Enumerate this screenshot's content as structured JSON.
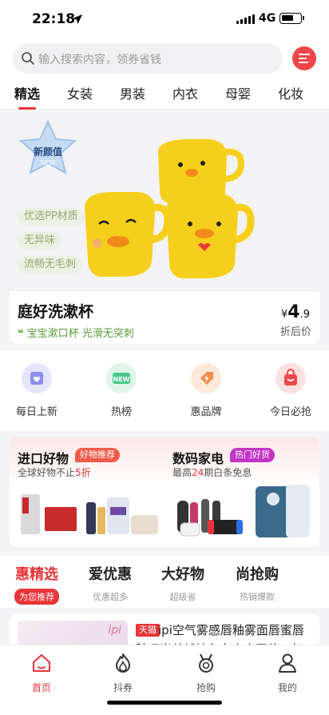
{
  "status": {
    "time": "22:18",
    "network": "4G"
  },
  "search": {
    "placeholder": "输入搜索内容，领券省钱"
  },
  "categories": [
    "精选",
    "女装",
    "男装",
    "内衣",
    "母婴",
    "化妆"
  ],
  "hero": {
    "badge_text": "新颜值",
    "badge_sub": "NEW",
    "features": [
      "优选PP材质",
      "无异味",
      "流畅无毛刺"
    ],
    "title": "庭好洗漱杯",
    "subtitle": "宝宝漱口杯 光滑无突刺",
    "currency": "¥",
    "price_int": "4",
    "price_dec": ".9",
    "price_label": "折后价"
  },
  "quick_links": [
    {
      "label": "每日上新",
      "icon": "calendar-heart-icon",
      "color": "#8c8ef0"
    },
    {
      "label": "热榜",
      "icon": "new-badge-icon",
      "color": "#4ac98c"
    },
    {
      "label": "惠品牌",
      "icon": "tag-lightning-icon",
      "color": "#f58a4a"
    },
    {
      "label": "今日必抢",
      "icon": "shopping-bag-icon",
      "color": "#f0464a"
    }
  ],
  "promo": {
    "left": {
      "title": "进口好物",
      "tag": "好物推荐",
      "sub_prefix": "全球好物不止",
      "sub_highlight": "5折",
      "sub_suffix": ""
    },
    "right": {
      "title": "数码家电",
      "tag": "热门好货",
      "sub_prefix": "最高",
      "sub_highlight": "24",
      "sub_suffix": "期白条免息"
    }
  },
  "sections": [
    {
      "title": "惠精选",
      "sub": "为您推荐"
    },
    {
      "title": "爱优惠",
      "sub": "优惠超多"
    },
    {
      "title": "大好物",
      "sub": "超级省"
    },
    {
      "title": "尚抢购",
      "sub": "热销爆款"
    }
  ],
  "product": {
    "brand_mark": "ipi",
    "store_tag": "天猫",
    "title": "ipi空气雾感唇釉雾面唇蜜唇",
    "title_line2": "釉哑光丝绒持久女小众平价口红"
  },
  "nav": [
    {
      "label": "首页",
      "icon": "home-icon"
    },
    {
      "label": "抖券",
      "icon": "flame-icon"
    },
    {
      "label": "抢购",
      "icon": "medal-icon"
    },
    {
      "label": "我的",
      "icon": "user-icon"
    }
  ],
  "colors": {
    "accent": "#e8343a",
    "green": "#5bb030",
    "yellow": "#f5c518"
  }
}
